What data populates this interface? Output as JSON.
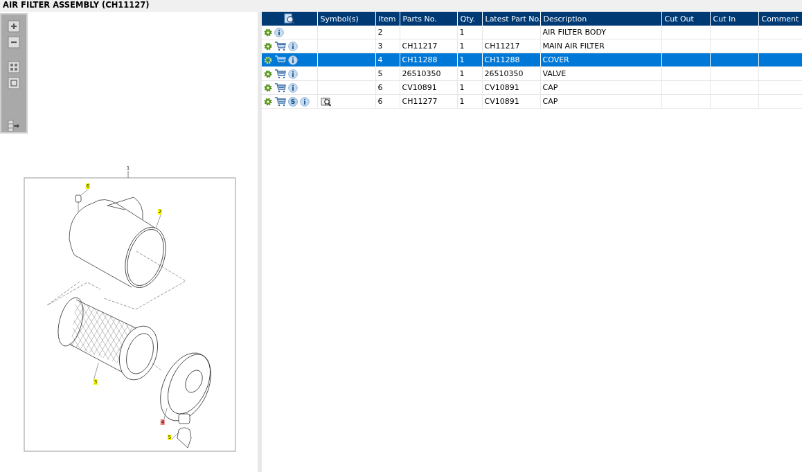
{
  "title": "AIR FILTER ASSEMBLY (CH11127)",
  "toolbar": [
    {
      "kind": "zoom-in"
    },
    {
      "kind": "zoom-out"
    },
    {
      "kind": "fit"
    },
    {
      "kind": "window"
    },
    {
      "kind": "export"
    }
  ],
  "diagram": {
    "callouts": [
      {
        "label": "1"
      },
      {
        "label": "6",
        "color": "#ffff00"
      },
      {
        "label": "2",
        "color": "#ffff00"
      },
      {
        "label": "3",
        "color": "#ffff00"
      },
      {
        "label": "4",
        "color": "#f08080"
      },
      {
        "label": "5",
        "color": "#ffff00"
      }
    ]
  },
  "table": {
    "columns": [
      "",
      "Symbol(s)",
      "Item",
      "Parts No.",
      "Qty.",
      "Latest Part No.",
      "Description",
      "Cut Out",
      "Cut In",
      "Comment"
    ],
    "rows": [
      {
        "selected": false,
        "cart": false,
        "badge": "",
        "symbol": false,
        "cells": [
          "",
          "",
          "2",
          "",
          "1",
          "",
          "AIR FILTER BODY",
          "",
          "",
          ""
        ]
      },
      {
        "selected": false,
        "cart": true,
        "badge": "",
        "symbol": false,
        "cells": [
          "",
          "",
          "3",
          "CH11217",
          "1",
          "CH11217",
          "MAIN AIR FILTER",
          "",
          "",
          ""
        ]
      },
      {
        "selected": true,
        "cart": true,
        "badge": "",
        "symbol": false,
        "cells": [
          "",
          "",
          "4",
          "CH11288",
          "1",
          "CH11288",
          "COVER",
          "",
          "",
          ""
        ]
      },
      {
        "selected": false,
        "cart": true,
        "badge": "",
        "symbol": false,
        "cells": [
          "",
          "",
          "5",
          "26510350",
          "1",
          "26510350",
          "VALVE",
          "",
          "",
          ""
        ]
      },
      {
        "selected": false,
        "cart": true,
        "badge": "",
        "symbol": false,
        "cells": [
          "",
          "",
          "6",
          "CV10891",
          "1",
          "CV10891",
          "CAP",
          "",
          "",
          ""
        ]
      },
      {
        "selected": false,
        "cart": true,
        "badge": "S",
        "symbol": true,
        "cells": [
          "",
          "",
          "6",
          "CH11277",
          "1",
          "CV10891",
          "CAP",
          "",
          "",
          ""
        ]
      }
    ]
  }
}
